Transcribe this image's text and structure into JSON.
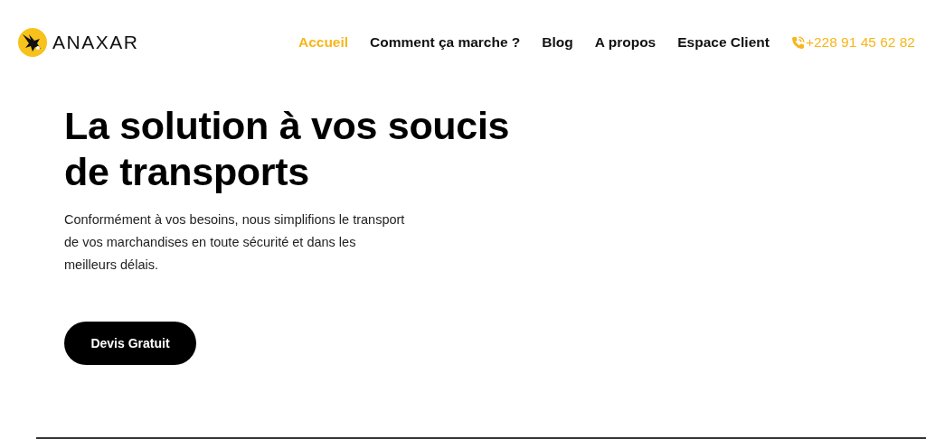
{
  "header": {
    "logo_text": "ANAXAR",
    "nav": [
      {
        "label": "Accueil",
        "selected": true
      },
      {
        "label": "Comment ça marche ?",
        "selected": false
      },
      {
        "label": "Blog",
        "selected": false
      },
      {
        "label": "A propos",
        "selected": false
      },
      {
        "label": "Espace Client",
        "selected": false
      }
    ],
    "phone": "+228 91 45 62 82"
  },
  "hero": {
    "title": "La solution à vos soucis de transports",
    "text": "Conformément à vos besoins, nous simplifions le transport de vos marchandises en toute sécurité et dans les meilleurs délais.",
    "button": "Devis Gratuit"
  }
}
